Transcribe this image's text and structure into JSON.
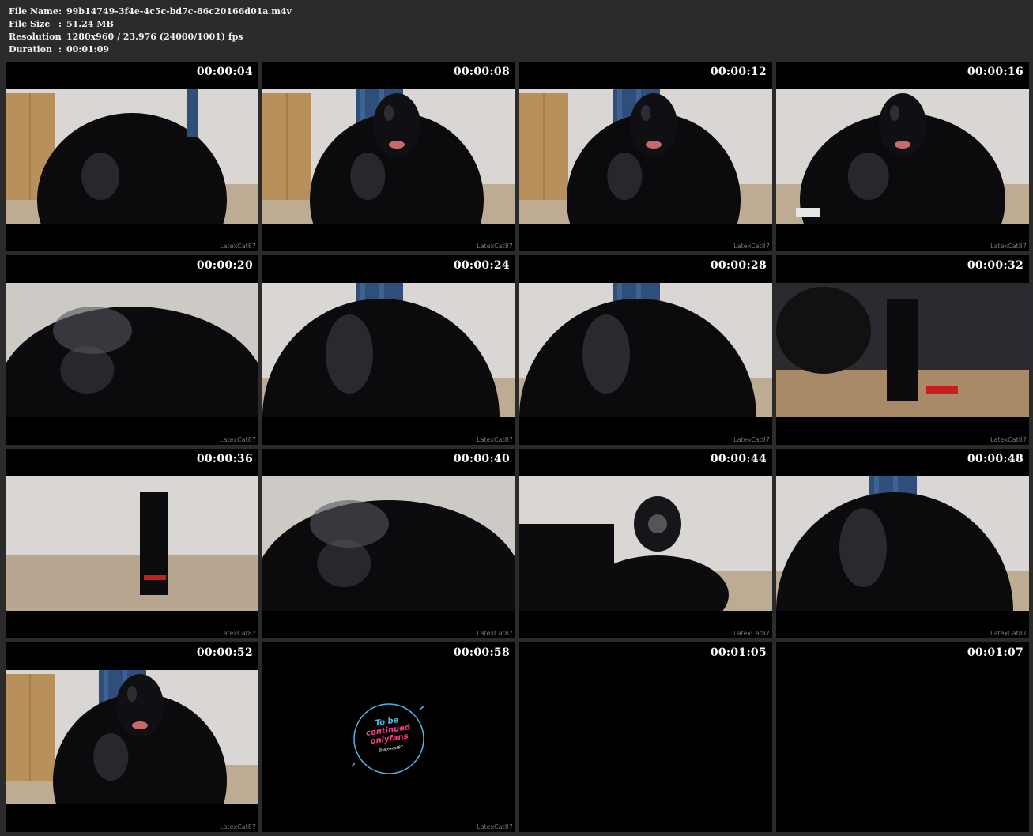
{
  "header": {
    "rows": [
      {
        "label": "File Name",
        "sep": ":",
        "value": "99b14749-3f4e-4c5c-bd7c-86c20166d01a.m4v"
      },
      {
        "label": "File Size",
        "sep": ":",
        "value": "51.24 MB"
      },
      {
        "label": "Resolution",
        "sep": ":",
        "value": "1280x960 / 23.976 (24000/1001) fps"
      },
      {
        "label": "Duration",
        "sep": ":",
        "value": "00:01:09"
      }
    ]
  },
  "watermark": "LatexCat87",
  "logo": {
    "line1": "To be",
    "line2": "continued",
    "line3": "onlyfans",
    "line4": "@latexcat87"
  },
  "colors": {
    "background": "#2b2b2b",
    "tile": "#000000",
    "accent_pink": "#ff3d8a",
    "accent_blue": "#4fb6e8"
  },
  "tiles": [
    {
      "timestamp": "00:00:04",
      "scene": "room-closeup"
    },
    {
      "timestamp": "00:00:08",
      "scene": "mask-curtain"
    },
    {
      "timestamp": "00:00:12",
      "scene": "mask-curtain"
    },
    {
      "timestamp": "00:00:16",
      "scene": "mask-room"
    },
    {
      "timestamp": "00:00:20",
      "scene": "closeup"
    },
    {
      "timestamp": "00:00:24",
      "scene": "room-figure"
    },
    {
      "timestamp": "00:00:28",
      "scene": "room-figure"
    },
    {
      "timestamp": "00:00:32",
      "scene": "chair-boots"
    },
    {
      "timestamp": "00:00:36",
      "scene": "floor-boots"
    },
    {
      "timestamp": "00:00:40",
      "scene": "closeup"
    },
    {
      "timestamp": "00:00:44",
      "scene": "gasmask"
    },
    {
      "timestamp": "00:00:48",
      "scene": "room-figure"
    },
    {
      "timestamp": "00:00:52",
      "scene": "mask-curtain"
    },
    {
      "timestamp": "00:00:58",
      "scene": "logo"
    },
    {
      "timestamp": "00:01:05",
      "scene": "black"
    },
    {
      "timestamp": "00:01:07",
      "scene": "black"
    }
  ]
}
